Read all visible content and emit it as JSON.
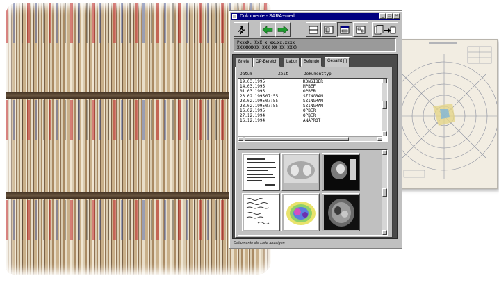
{
  "window": {
    "title": "Dokumente - SARA+med",
    "controls": {
      "minimize": "_",
      "maximize": "□",
      "close": "×"
    }
  },
  "toolbar": {
    "icons": [
      "run-icon",
      "arrow-left-icon",
      "arrow-right-icon",
      "view-single-icon",
      "view-split-icon",
      "view-window-icon",
      "view-tile-icon",
      "export-icon"
    ]
  },
  "patient": {
    "line1": "PxxxX, XxX       x      xx.xx.xxxx",
    "line2": "XXXXXXXXX XXX XX XX.XXX)"
  },
  "tabs": [
    {
      "label": "Briefe",
      "active": false
    },
    {
      "label": "OP-Bereich",
      "active": false
    },
    {
      "label": "Labor",
      "active": false
    },
    {
      "label": "Befunde",
      "active": false
    },
    {
      "label": "Gesamt (!)",
      "active": true
    }
  ],
  "list": {
    "columns": {
      "date": "Datum",
      "time": "Zeit",
      "type": "Dokumenttyp"
    },
    "rows": [
      {
        "date": "19.03.1995",
        "time": "",
        "type": "KONSIBER"
      },
      {
        "date": "14.03.1995",
        "time": "",
        "type": "MPBEF"
      },
      {
        "date": "01.03.1995",
        "time": "",
        "type": "OPBER"
      },
      {
        "date": "23.02.1995",
        "time": "07:55",
        "type": "SZINGRAM"
      },
      {
        "date": "23.02.1995",
        "time": "07:55",
        "type": "SZINGRAM"
      },
      {
        "date": "23.02.1995",
        "time": "07:55",
        "type": "SZINGRAM"
      },
      {
        "date": "16.02.1995",
        "time": "",
        "type": "OPBER"
      },
      {
        "date": "27.12.1994",
        "time": "",
        "type": "OPBER"
      },
      {
        "date": "16.12.1994",
        "time": "",
        "type": "ANÄPROT"
      }
    ]
  },
  "thumbnails": [
    "document-scan-thumbnail",
    "xray-thumbnail",
    "ct-scan-thumbnail",
    "handwritten-document-thumbnail",
    "scintigram-thumbnail",
    "mri-scan-thumbnail"
  ],
  "status": {
    "text": "Dokumente als Liste anzeigen"
  },
  "colors": {
    "titlebar": "#000080",
    "window": "#c0c0c0",
    "frame": "#4a4a4a",
    "arrow_green": "#1e9a2e"
  }
}
